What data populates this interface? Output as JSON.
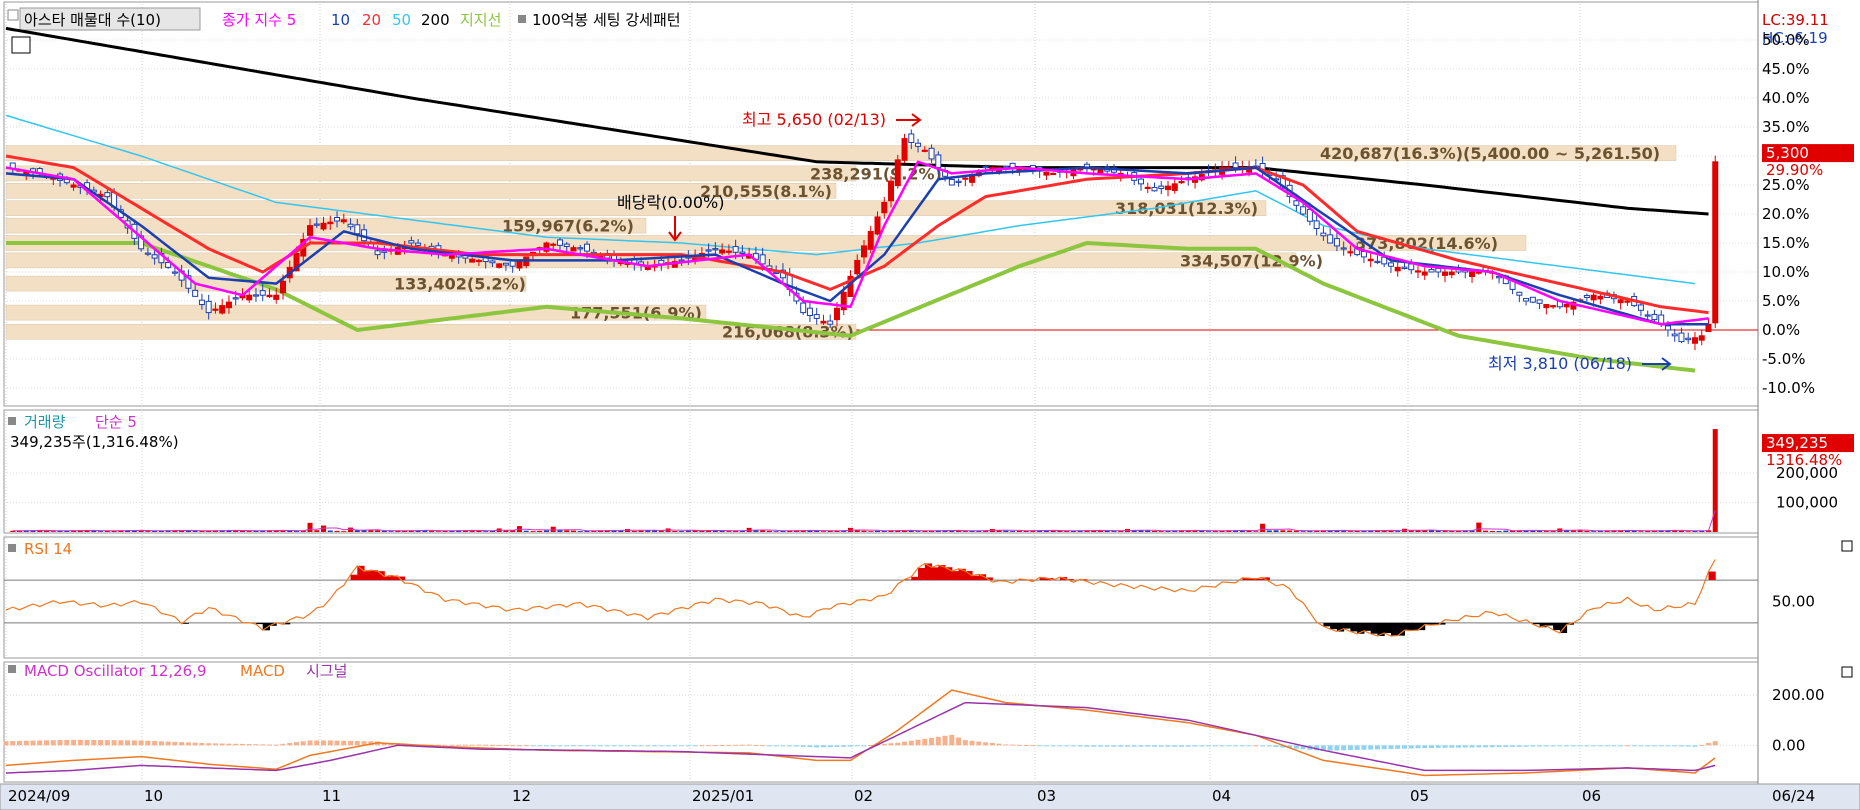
{
  "header": {
    "symbol_label": "아스타 매물대 수(10)",
    "ma_title": "종가 지수 5",
    "ma_periods": [
      "10",
      "20",
      "50",
      "200"
    ],
    "support_label": "지지선",
    "pattern_label": "100억봉 세팅 강세패턴",
    "lc": "LC:39.11",
    "hc": "HC:-6.19"
  },
  "colors": {
    "up": "#e00000",
    "down": "#1a3fb0",
    "ma5": "#ff00ff",
    "ma10": "#1a3fb0",
    "ma20": "#ff2a2a",
    "ma50": "#33c6f0",
    "ma200": "#000000",
    "support": "#8cc63f",
    "band": "#f3dfc3",
    "rsi": "#f07820",
    "macd": "#f07820",
    "signal": "#9933aa",
    "osc_pos": "#f6b08a",
    "osc_neg": "#8fd3f0"
  },
  "chart_data": [
    {
      "type": "candlestick",
      "panel": "price",
      "ylabel_unit": "%",
      "ylim": [
        -10,
        50
      ],
      "y_ticks": [
        "50.0%",
        "45.0%",
        "40.0%",
        "35.0%",
        "30.0%",
        "25.0%",
        "20.0%",
        "15.0%",
        "10.0%",
        "5.0%",
        "0.0%",
        "-5.0%",
        "-10.0%"
      ],
      "x_months": [
        "2024/09",
        "10",
        "11",
        "12",
        "2025/01",
        "02",
        "03",
        "04",
        "05",
        "06",
        "06/24"
      ],
      "close_path": [
        [
          0,
          28
        ],
        [
          5,
          27
        ],
        [
          10,
          25
        ],
        [
          15,
          23
        ],
        [
          20,
          14
        ],
        [
          25,
          10
        ],
        [
          30,
          3
        ],
        [
          35,
          6
        ],
        [
          40,
          6
        ],
        [
          45,
          18
        ],
        [
          50,
          19
        ],
        [
          55,
          13
        ],
        [
          60,
          15
        ],
        [
          65,
          13
        ],
        [
          70,
          12
        ],
        [
          75,
          11
        ],
        [
          80,
          15
        ],
        [
          85,
          14
        ],
        [
          90,
          12
        ],
        [
          95,
          11
        ],
        [
          100,
          12
        ],
        [
          105,
          14
        ],
        [
          110,
          13
        ],
        [
          115,
          9
        ],
        [
          118,
          3
        ],
        [
          122,
          1
        ],
        [
          126,
          12
        ],
        [
          130,
          22
        ],
        [
          133,
          33
        ],
        [
          136,
          31
        ],
        [
          140,
          25
        ],
        [
          145,
          28
        ],
        [
          150,
          28
        ],
        [
          155,
          27
        ],
        [
          160,
          28
        ],
        [
          165,
          27
        ],
        [
          170,
          24
        ],
        [
          175,
          26
        ],
        [
          180,
          28
        ],
        [
          185,
          28
        ],
        [
          188,
          26
        ],
        [
          192,
          20
        ],
        [
          196,
          15
        ],
        [
          200,
          13
        ],
        [
          205,
          11
        ],
        [
          210,
          10
        ],
        [
          215,
          10
        ],
        [
          220,
          10
        ],
        [
          225,
          5
        ],
        [
          230,
          4
        ],
        [
          235,
          6
        ],
        [
          240,
          5
        ],
        [
          245,
          1
        ],
        [
          248,
          -2
        ],
        [
          251,
          -1
        ],
        [
          252,
          1
        ],
        [
          253,
          29
        ]
      ],
      "ma5_path": [
        [
          0,
          28
        ],
        [
          10,
          26
        ],
        [
          20,
          16
        ],
        [
          28,
          8
        ],
        [
          35,
          6
        ],
        [
          45,
          16
        ],
        [
          55,
          14
        ],
        [
          65,
          13
        ],
        [
          80,
          14
        ],
        [
          95,
          11
        ],
        [
          110,
          13
        ],
        [
          118,
          5
        ],
        [
          125,
          4
        ],
        [
          130,
          18
        ],
        [
          135,
          29
        ],
        [
          140,
          27
        ],
        [
          150,
          28
        ],
        [
          160,
          27
        ],
        [
          175,
          26
        ],
        [
          185,
          27
        ],
        [
          192,
          22
        ],
        [
          200,
          14
        ],
        [
          210,
          11
        ],
        [
          220,
          10
        ],
        [
          230,
          5
        ],
        [
          245,
          1
        ],
        [
          252,
          2
        ]
      ],
      "ma10_path": [
        [
          0,
          27
        ],
        [
          10,
          26
        ],
        [
          20,
          18
        ],
        [
          30,
          9
        ],
        [
          40,
          8
        ],
        [
          50,
          17
        ],
        [
          60,
          14
        ],
        [
          75,
          12
        ],
        [
          90,
          12
        ],
        [
          105,
          13
        ],
        [
          115,
          8
        ],
        [
          122,
          5
        ],
        [
          130,
          13
        ],
        [
          138,
          26
        ],
        [
          145,
          27
        ],
        [
          160,
          28
        ],
        [
          175,
          27
        ],
        [
          185,
          28
        ],
        [
          195,
          20
        ],
        [
          205,
          12
        ],
        [
          220,
          10
        ],
        [
          230,
          6
        ],
        [
          245,
          1
        ],
        [
          252,
          1
        ]
      ],
      "ma20_path": [
        [
          0,
          30
        ],
        [
          10,
          28
        ],
        [
          20,
          21
        ],
        [
          30,
          14
        ],
        [
          38,
          10
        ],
        [
          45,
          15
        ],
        [
          55,
          15
        ],
        [
          70,
          13
        ],
        [
          85,
          13
        ],
        [
          100,
          13
        ],
        [
          115,
          10
        ],
        [
          122,
          7
        ],
        [
          130,
          11
        ],
        [
          138,
          18
        ],
        [
          145,
          23
        ],
        [
          160,
          26
        ],
        [
          175,
          27
        ],
        [
          185,
          28
        ],
        [
          192,
          25
        ],
        [
          200,
          17
        ],
        [
          215,
          12
        ],
        [
          230,
          8
        ],
        [
          245,
          4
        ],
        [
          252,
          3
        ]
      ],
      "ma50_path": [
        [
          0,
          37
        ],
        [
          20,
          30
        ],
        [
          40,
          22
        ],
        [
          60,
          19
        ],
        [
          80,
          16
        ],
        [
          100,
          15
        ],
        [
          120,
          13
        ],
        [
          135,
          15
        ],
        [
          150,
          18
        ],
        [
          170,
          21
        ],
        [
          185,
          24
        ],
        [
          195,
          18
        ],
        [
          210,
          14
        ],
        [
          230,
          11
        ],
        [
          250,
          8
        ]
      ],
      "ma200_path": [
        [
          0,
          52
        ],
        [
          60,
          40
        ],
        [
          120,
          29
        ],
        [
          150,
          28
        ],
        [
          175,
          28
        ],
        [
          185,
          28
        ],
        [
          210,
          25
        ],
        [
          240,
          21
        ],
        [
          252,
          20
        ]
      ],
      "support_path": [
        [
          0,
          15
        ],
        [
          20,
          15
        ],
        [
          40,
          7
        ],
        [
          52,
          0
        ],
        [
          80,
          4
        ],
        [
          90,
          3
        ],
        [
          100,
          2
        ],
        [
          125,
          -1
        ],
        [
          150,
          11
        ],
        [
          160,
          15
        ],
        [
          175,
          14
        ],
        [
          185,
          14
        ],
        [
          195,
          8
        ],
        [
          215,
          -1
        ],
        [
          235,
          -5
        ],
        [
          250,
          -7
        ]
      ],
      "volume_profile": [
        {
          "y": 30.5,
          "label": "420,687(16.3%)(5,400.00 ~ 5,261.50)"
        },
        {
          "y": 27.0,
          "label": "238,291(9.2%)"
        },
        {
          "y": 24.0,
          "label": "210,555(8.1%)"
        },
        {
          "y": 21.0,
          "label": "318,031(12.3%)"
        },
        {
          "y": 18.0,
          "label": "159,967(6.2%)"
        },
        {
          "y": 15.0,
          "label": "373,802(14.6%)"
        },
        {
          "y": 12.0,
          "label": "334,507(12.9%)"
        },
        {
          "y": 8.0,
          "label": "133,402(5.2%)"
        },
        {
          "y": 3.0,
          "label": "177,551(6.9%)"
        },
        {
          "y": -0.3,
          "label": "216,068(8.3%)"
        }
      ],
      "annotations": {
        "high": "최고 5,650 (02/13)",
        "low": "최저 3,810 (06/18)",
        "dividend": "배당락(0.00%)",
        "last_price": "5,300",
        "last_pct": "29.90%"
      }
    },
    {
      "type": "bar",
      "panel": "volume",
      "title": "거래량",
      "ma_label": "단순 5",
      "info": "349,235주(1,316.48%)",
      "y_ticks": [
        "200,000",
        "100,000"
      ],
      "ylim": [
        0,
        380000
      ],
      "last_value": "349,235",
      "last_pct": "1316.48%",
      "spikes": [
        [
          45,
          31000
        ],
        [
          47,
          22000
        ],
        [
          51,
          15000
        ],
        [
          73,
          12000
        ],
        [
          76,
          20000
        ],
        [
          81,
          18000
        ],
        [
          92,
          10000
        ],
        [
          98,
          12000
        ],
        [
          110,
          14000
        ],
        [
          125,
          14000
        ],
        [
          146,
          10000
        ],
        [
          166,
          10000
        ],
        [
          186,
          28000
        ],
        [
          207,
          11000
        ],
        [
          218,
          32000
        ],
        [
          230,
          12000
        ],
        [
          253,
          349235
        ]
      ]
    },
    {
      "type": "line",
      "panel": "rsi",
      "title": "RSI 14",
      "ylim": [
        0,
        100
      ],
      "levels": [
        30,
        70
      ],
      "y_ticks": [
        "50.00"
      ],
      "points": [
        [
          0,
          42
        ],
        [
          8,
          50
        ],
        [
          15,
          46
        ],
        [
          20,
          50
        ],
        [
          26,
          31
        ],
        [
          30,
          44
        ],
        [
          38,
          25
        ],
        [
          45,
          38
        ],
        [
          48,
          52
        ],
        [
          52,
          82
        ],
        [
          58,
          72
        ],
        [
          65,
          52
        ],
        [
          75,
          42
        ],
        [
          85,
          48
        ],
        [
          95,
          35
        ],
        [
          105,
          52
        ],
        [
          112,
          48
        ],
        [
          118,
          35
        ],
        [
          122,
          45
        ],
        [
          130,
          55
        ],
        [
          136,
          85
        ],
        [
          142,
          78
        ],
        [
          147,
          68
        ],
        [
          155,
          72
        ],
        [
          165,
          65
        ],
        [
          175,
          60
        ],
        [
          185,
          73
        ],
        [
          190,
          62
        ],
        [
          195,
          25
        ],
        [
          205,
          18
        ],
        [
          212,
          30
        ],
        [
          220,
          40
        ],
        [
          230,
          22
        ],
        [
          235,
          44
        ],
        [
          240,
          52
        ],
        [
          244,
          42
        ],
        [
          250,
          48
        ],
        [
          253,
          90
        ]
      ]
    },
    {
      "type": "line",
      "panel": "macd",
      "title": "MACD Oscillator 12,26,9",
      "series": [
        {
          "name": "MACD"
        },
        {
          "name": "시그널"
        }
      ],
      "ylim": [
        -150,
        260
      ],
      "y_ticks": [
        "200.00",
        "0.00"
      ],
      "macd": [
        [
          0,
          -80
        ],
        [
          10,
          -60
        ],
        [
          20,
          -45
        ],
        [
          30,
          -75
        ],
        [
          40,
          -95
        ],
        [
          45,
          -40
        ],
        [
          55,
          10
        ],
        [
          65,
          -5
        ],
        [
          80,
          -20
        ],
        [
          95,
          -25
        ],
        [
          110,
          -30
        ],
        [
          120,
          -60
        ],
        [
          125,
          -60
        ],
        [
          132,
          60
        ],
        [
          140,
          220
        ],
        [
          148,
          170
        ],
        [
          160,
          140
        ],
        [
          175,
          90
        ],
        [
          185,
          40
        ],
        [
          195,
          -60
        ],
        [
          210,
          -120
        ],
        [
          225,
          -110
        ],
        [
          240,
          -90
        ],
        [
          250,
          -110
        ],
        [
          253,
          -50
        ]
      ],
      "signal": [
        [
          0,
          -110
        ],
        [
          10,
          -100
        ],
        [
          20,
          -80
        ],
        [
          30,
          -90
        ],
        [
          40,
          -100
        ],
        [
          48,
          -60
        ],
        [
          58,
          0
        ],
        [
          70,
          -15
        ],
        [
          85,
          -20
        ],
        [
          100,
          -25
        ],
        [
          115,
          -40
        ],
        [
          125,
          -50
        ],
        [
          135,
          80
        ],
        [
          142,
          170
        ],
        [
          160,
          150
        ],
        [
          175,
          100
        ],
        [
          185,
          40
        ],
        [
          195,
          -20
        ],
        [
          210,
          -100
        ],
        [
          225,
          -100
        ],
        [
          240,
          -90
        ],
        [
          250,
          -100
        ],
        [
          253,
          -80
        ]
      ]
    }
  ]
}
